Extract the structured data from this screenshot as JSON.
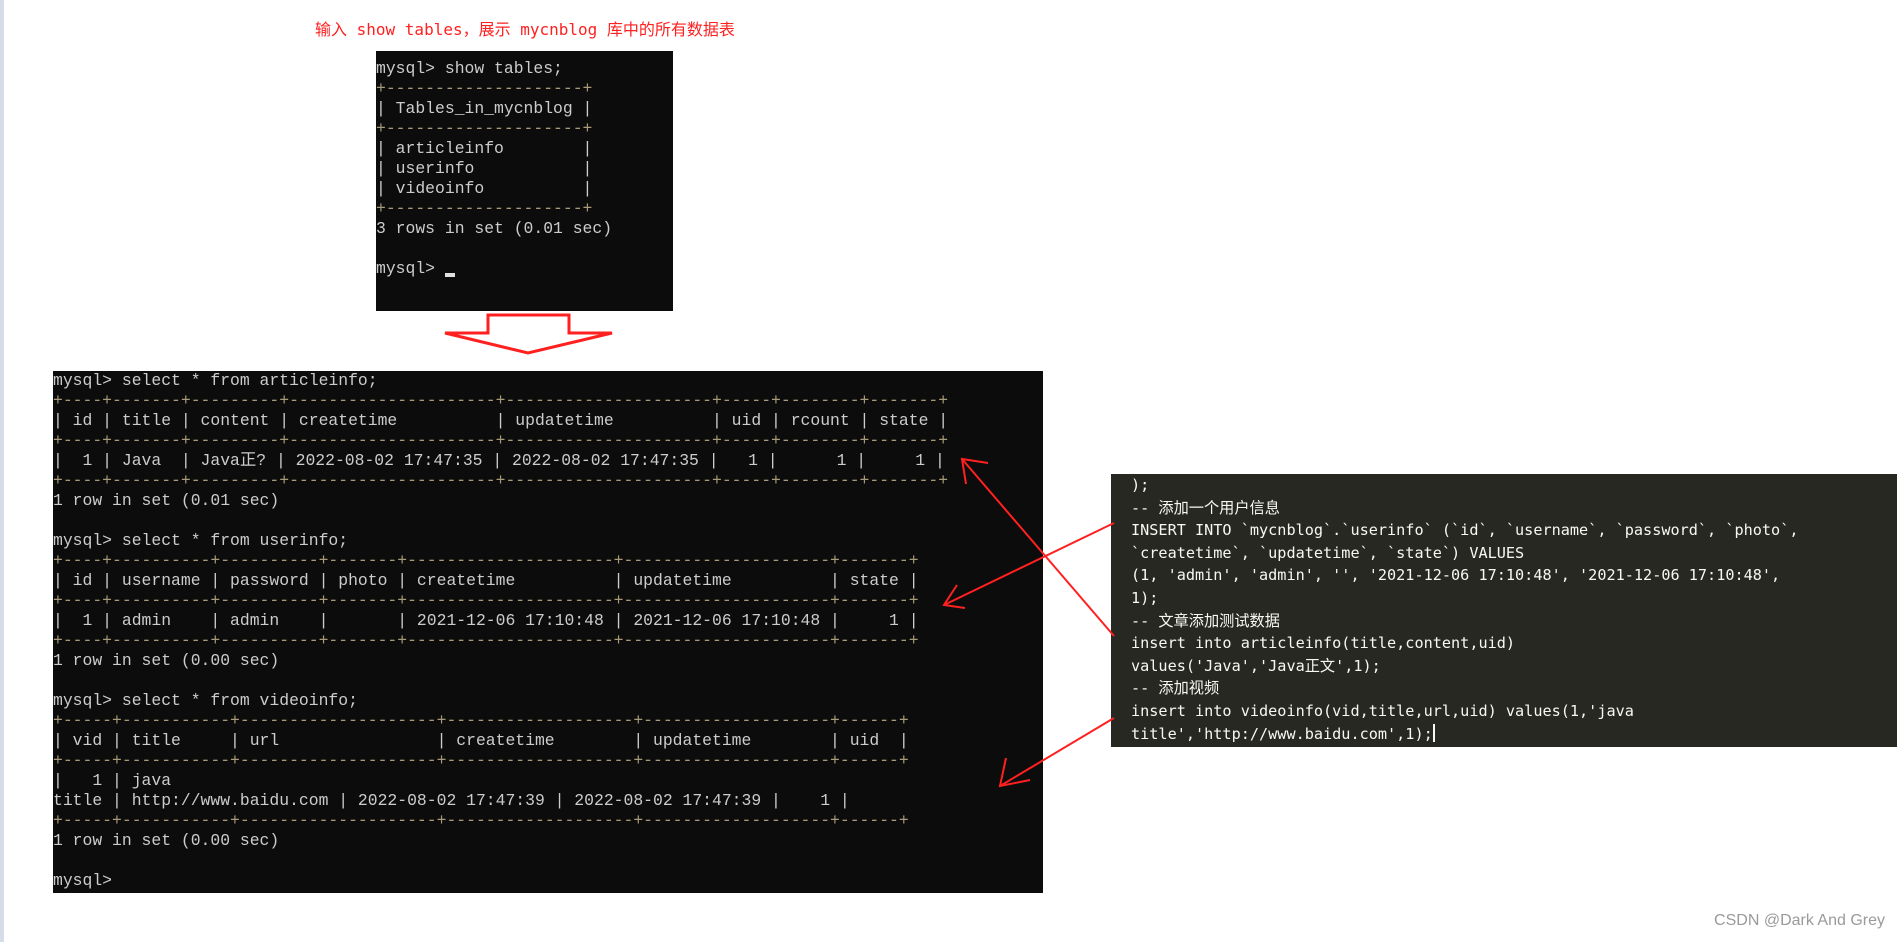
{
  "caption": "输入 show tables，展示 mycnblog 库中的所有数据表",
  "terminal_show_tables": {
    "lines": [
      "mysql> show tables;",
      "+--------------------+",
      "| Tables_in_mycnblog |",
      "+--------------------+",
      "| articleinfo        |",
      "| userinfo           |",
      "| videoinfo          |",
      "+--------------------+",
      "3 rows in set (0.01 sec)",
      "",
      "mysql> "
    ]
  },
  "terminal_selects": {
    "lines": [
      "mysql> select * from articleinfo;",
      "+----+-------+---------+---------------------+---------------------+-----+--------+-------+",
      "| id | title | content | createtime          | updatetime          | uid | rcount | state |",
      "+----+-------+---------+---------------------+---------------------+-----+--------+-------+",
      "|  1 | Java  | Java正? | 2022-08-02 17:47:35 | 2022-08-02 17:47:35 |   1 |      1 |     1 |",
      "+----+-------+---------+---------------------+---------------------+-----+--------+-------+",
      "1 row in set (0.01 sec)",
      "",
      "mysql> select * from userinfo;",
      "+----+----------+----------+-------+---------------------+---------------------+-------+",
      "| id | username | password | photo | createtime          | updatetime          | state |",
      "+----+----------+----------+-------+---------------------+---------------------+-------+",
      "|  1 | admin    | admin    |       | 2021-12-06 17:10:48 | 2021-12-06 17:10:48 |     1 |",
      "+----+----------+----------+-------+---------------------+---------------------+-------+",
      "1 row in set (0.00 sec)",
      "",
      "mysql> select * from videoinfo;",
      "+-----+-----------+--------------------+-------------------+-------------------+------+",
      "| vid | title     | url                | createtime        | updatetime        | uid  |",
      "+-----+-----------+--------------------+-------------------+-------------------+------+",
      "|   1 | java",
      "title | http://www.baidu.com | 2022-08-02 17:47:39 | 2022-08-02 17:47:39 |    1 |",
      "+-----+-----------+--------------------+-------------------+-------------------+------+",
      "1 row in set (0.00 sec)",
      "",
      "mysql>"
    ]
  },
  "sql_editor": {
    "lines": [
      ");",
      "-- 添加一个用户信息",
      "INSERT INTO `mycnblog`.`userinfo` (`id`, `username`, `password`, `photo`,",
      "`createtime`, `updatetime`, `state`) VALUES",
      "(1, 'admin', 'admin', '', '2021-12-06 17:10:48', '2021-12-06 17:10:48',",
      "1);",
      "-- 文章添加测试数据",
      "insert into articleinfo(title,content,uid)",
      "values('Java','Java正文',1);",
      "-- 添加视频",
      "insert into videoinfo(vid,title,url,uid) values(1,'java",
      "title','http://www.baidu.com',1);"
    ]
  },
  "watermark": "CSDN @Dark And Grey",
  "colors": {
    "annotation": "#ff2020",
    "terminal_bg": "#0c0c0c",
    "editor_bg": "#272822"
  }
}
